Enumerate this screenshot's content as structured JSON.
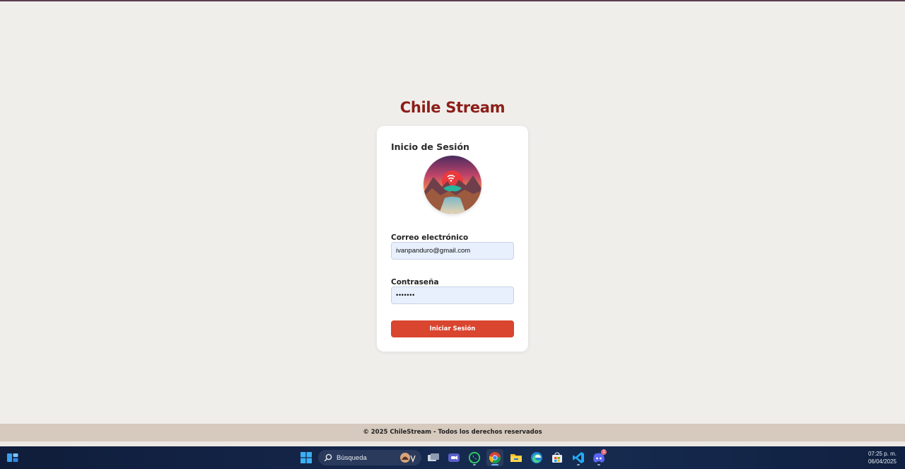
{
  "site": {
    "title": "Chile Stream"
  },
  "login": {
    "heading": "Inicio de Sesión",
    "logo_icon": "chile-stream-logo-icon",
    "email_label": "Correo electrónico",
    "email_value": "ivanpanduro@gmail.com",
    "password_label": "Contraseña",
    "password_value": "•••••••",
    "submit_label": "Iniciar Sesión"
  },
  "footer": {
    "text": "© 2025 ChileStream - Todos los derechos reservados"
  },
  "taskbar": {
    "search_label": "Búsqueda",
    "time": "07:25 p. m.",
    "date": "06/04/2025",
    "discord_badge": "1",
    "icons": [
      "widgets-icon",
      "windows-start-icon",
      "search-icon",
      "task-view-icon",
      "teams-icon",
      "whatsapp-icon",
      "chrome-icon",
      "file-explorer-icon",
      "edge-icon",
      "store-icon",
      "vscode-icon",
      "discord-icon"
    ]
  },
  "colors": {
    "brand_title": "#8b1e18",
    "button": "#d9452f",
    "page_bg": "#f0eeeb",
    "footer_bg": "#d6c9bd",
    "input_bg": "#e8f0fe"
  }
}
